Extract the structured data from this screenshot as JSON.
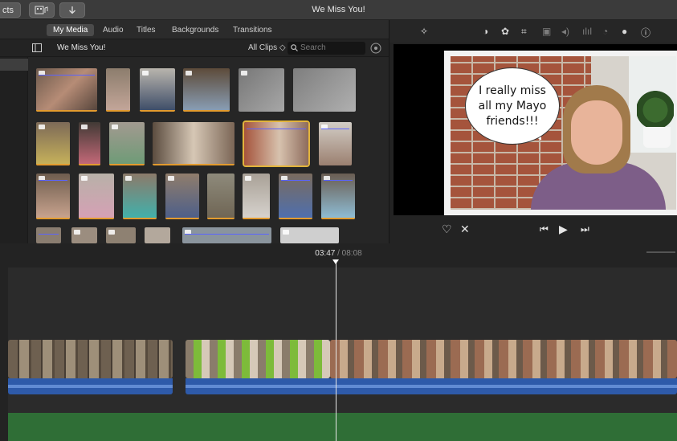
{
  "window": {
    "title": "We Miss You!",
    "left_button_label": "cts",
    "import_icon": "arrow-down-icon",
    "media_icon": "film-music-icon"
  },
  "browser": {
    "tabs": [
      {
        "label": "My Media",
        "active": true
      },
      {
        "label": "Audio",
        "active": false
      },
      {
        "label": "Titles",
        "active": false
      },
      {
        "label": "Backgrounds",
        "active": false
      },
      {
        "label": "Transitions",
        "active": false
      }
    ],
    "project_name": "We Miss You!",
    "filter": "All Clips ◇",
    "search_placeholder": "Search"
  },
  "viewer": {
    "bubble_text": "I really miss all my Mayo friends!!!",
    "tools": [
      "magic-wand-icon",
      "color-balance-icon",
      "palette-icon",
      "crop-icon",
      "stabilize-icon",
      "volume-icon",
      "equalizer-icon",
      "speed-icon",
      "filter-icon",
      "info-icon"
    ]
  },
  "timeline": {
    "current_time": "03:47",
    "separator": "/",
    "total_time": "08:08"
  },
  "colors": {
    "accent_orange": "#e39b2e",
    "selection_yellow": "#e2b43c",
    "audio_blue": "#2e5aa9",
    "music_green": "#2f6e36"
  }
}
